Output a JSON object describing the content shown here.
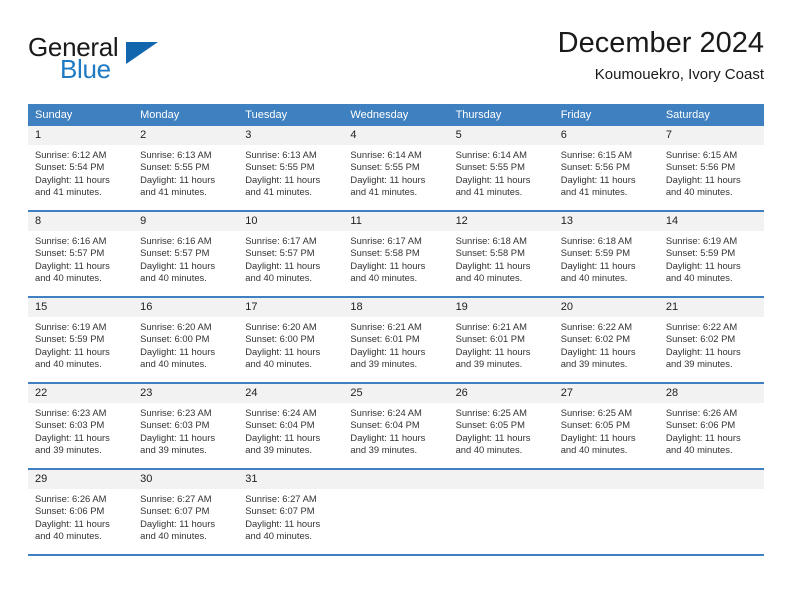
{
  "logo": {
    "word1": "General",
    "word2": "Blue",
    "triangle_color": "#1266ae",
    "blue_color": "#1f7ac4"
  },
  "header": {
    "title": "December 2024",
    "subtitle": "Koumouekro, Ivory Coast"
  },
  "calendar": {
    "header_color": "#3f80c0",
    "daynum_bg": "#f2f2f2",
    "weekdays": [
      "Sunday",
      "Monday",
      "Tuesday",
      "Wednesday",
      "Thursday",
      "Friday",
      "Saturday"
    ],
    "weeks": [
      [
        {
          "day": "1",
          "sunrise": "Sunrise: 6:12 AM",
          "sunset": "Sunset: 5:54 PM",
          "daylight1": "Daylight: 11 hours",
          "daylight2": "and 41 minutes."
        },
        {
          "day": "2",
          "sunrise": "Sunrise: 6:13 AM",
          "sunset": "Sunset: 5:55 PM",
          "daylight1": "Daylight: 11 hours",
          "daylight2": "and 41 minutes."
        },
        {
          "day": "3",
          "sunrise": "Sunrise: 6:13 AM",
          "sunset": "Sunset: 5:55 PM",
          "daylight1": "Daylight: 11 hours",
          "daylight2": "and 41 minutes."
        },
        {
          "day": "4",
          "sunrise": "Sunrise: 6:14 AM",
          "sunset": "Sunset: 5:55 PM",
          "daylight1": "Daylight: 11 hours",
          "daylight2": "and 41 minutes."
        },
        {
          "day": "5",
          "sunrise": "Sunrise: 6:14 AM",
          "sunset": "Sunset: 5:55 PM",
          "daylight1": "Daylight: 11 hours",
          "daylight2": "and 41 minutes."
        },
        {
          "day": "6",
          "sunrise": "Sunrise: 6:15 AM",
          "sunset": "Sunset: 5:56 PM",
          "daylight1": "Daylight: 11 hours",
          "daylight2": "and 41 minutes."
        },
        {
          "day": "7",
          "sunrise": "Sunrise: 6:15 AM",
          "sunset": "Sunset: 5:56 PM",
          "daylight1": "Daylight: 11 hours",
          "daylight2": "and 40 minutes."
        }
      ],
      [
        {
          "day": "8",
          "sunrise": "Sunrise: 6:16 AM",
          "sunset": "Sunset: 5:57 PM",
          "daylight1": "Daylight: 11 hours",
          "daylight2": "and 40 minutes."
        },
        {
          "day": "9",
          "sunrise": "Sunrise: 6:16 AM",
          "sunset": "Sunset: 5:57 PM",
          "daylight1": "Daylight: 11 hours",
          "daylight2": "and 40 minutes."
        },
        {
          "day": "10",
          "sunrise": "Sunrise: 6:17 AM",
          "sunset": "Sunset: 5:57 PM",
          "daylight1": "Daylight: 11 hours",
          "daylight2": "and 40 minutes."
        },
        {
          "day": "11",
          "sunrise": "Sunrise: 6:17 AM",
          "sunset": "Sunset: 5:58 PM",
          "daylight1": "Daylight: 11 hours",
          "daylight2": "and 40 minutes."
        },
        {
          "day": "12",
          "sunrise": "Sunrise: 6:18 AM",
          "sunset": "Sunset: 5:58 PM",
          "daylight1": "Daylight: 11 hours",
          "daylight2": "and 40 minutes."
        },
        {
          "day": "13",
          "sunrise": "Sunrise: 6:18 AM",
          "sunset": "Sunset: 5:59 PM",
          "daylight1": "Daylight: 11 hours",
          "daylight2": "and 40 minutes."
        },
        {
          "day": "14",
          "sunrise": "Sunrise: 6:19 AM",
          "sunset": "Sunset: 5:59 PM",
          "daylight1": "Daylight: 11 hours",
          "daylight2": "and 40 minutes."
        }
      ],
      [
        {
          "day": "15",
          "sunrise": "Sunrise: 6:19 AM",
          "sunset": "Sunset: 5:59 PM",
          "daylight1": "Daylight: 11 hours",
          "daylight2": "and 40 minutes."
        },
        {
          "day": "16",
          "sunrise": "Sunrise: 6:20 AM",
          "sunset": "Sunset: 6:00 PM",
          "daylight1": "Daylight: 11 hours",
          "daylight2": "and 40 minutes."
        },
        {
          "day": "17",
          "sunrise": "Sunrise: 6:20 AM",
          "sunset": "Sunset: 6:00 PM",
          "daylight1": "Daylight: 11 hours",
          "daylight2": "and 40 minutes."
        },
        {
          "day": "18",
          "sunrise": "Sunrise: 6:21 AM",
          "sunset": "Sunset: 6:01 PM",
          "daylight1": "Daylight: 11 hours",
          "daylight2": "and 39 minutes."
        },
        {
          "day": "19",
          "sunrise": "Sunrise: 6:21 AM",
          "sunset": "Sunset: 6:01 PM",
          "daylight1": "Daylight: 11 hours",
          "daylight2": "and 39 minutes."
        },
        {
          "day": "20",
          "sunrise": "Sunrise: 6:22 AM",
          "sunset": "Sunset: 6:02 PM",
          "daylight1": "Daylight: 11 hours",
          "daylight2": "and 39 minutes."
        },
        {
          "day": "21",
          "sunrise": "Sunrise: 6:22 AM",
          "sunset": "Sunset: 6:02 PM",
          "daylight1": "Daylight: 11 hours",
          "daylight2": "and 39 minutes."
        }
      ],
      [
        {
          "day": "22",
          "sunrise": "Sunrise: 6:23 AM",
          "sunset": "Sunset: 6:03 PM",
          "daylight1": "Daylight: 11 hours",
          "daylight2": "and 39 minutes."
        },
        {
          "day": "23",
          "sunrise": "Sunrise: 6:23 AM",
          "sunset": "Sunset: 6:03 PM",
          "daylight1": "Daylight: 11 hours",
          "daylight2": "and 39 minutes."
        },
        {
          "day": "24",
          "sunrise": "Sunrise: 6:24 AM",
          "sunset": "Sunset: 6:04 PM",
          "daylight1": "Daylight: 11 hours",
          "daylight2": "and 39 minutes."
        },
        {
          "day": "25",
          "sunrise": "Sunrise: 6:24 AM",
          "sunset": "Sunset: 6:04 PM",
          "daylight1": "Daylight: 11 hours",
          "daylight2": "and 39 minutes."
        },
        {
          "day": "26",
          "sunrise": "Sunrise: 6:25 AM",
          "sunset": "Sunset: 6:05 PM",
          "daylight1": "Daylight: 11 hours",
          "daylight2": "and 40 minutes."
        },
        {
          "day": "27",
          "sunrise": "Sunrise: 6:25 AM",
          "sunset": "Sunset: 6:05 PM",
          "daylight1": "Daylight: 11 hours",
          "daylight2": "and 40 minutes."
        },
        {
          "day": "28",
          "sunrise": "Sunrise: 6:26 AM",
          "sunset": "Sunset: 6:06 PM",
          "daylight1": "Daylight: 11 hours",
          "daylight2": "and 40 minutes."
        }
      ],
      [
        {
          "day": "29",
          "sunrise": "Sunrise: 6:26 AM",
          "sunset": "Sunset: 6:06 PM",
          "daylight1": "Daylight: 11 hours",
          "daylight2": "and 40 minutes."
        },
        {
          "day": "30",
          "sunrise": "Sunrise: 6:27 AM",
          "sunset": "Sunset: 6:07 PM",
          "daylight1": "Daylight: 11 hours",
          "daylight2": "and 40 minutes."
        },
        {
          "day": "31",
          "sunrise": "Sunrise: 6:27 AM",
          "sunset": "Sunset: 6:07 PM",
          "daylight1": "Daylight: 11 hours",
          "daylight2": "and 40 minutes."
        },
        {
          "day": "",
          "sunrise": "",
          "sunset": "",
          "daylight1": "",
          "daylight2": ""
        },
        {
          "day": "",
          "sunrise": "",
          "sunset": "",
          "daylight1": "",
          "daylight2": ""
        },
        {
          "day": "",
          "sunrise": "",
          "sunset": "",
          "daylight1": "",
          "daylight2": ""
        },
        {
          "day": "",
          "sunrise": "",
          "sunset": "",
          "daylight1": "",
          "daylight2": ""
        }
      ]
    ]
  }
}
